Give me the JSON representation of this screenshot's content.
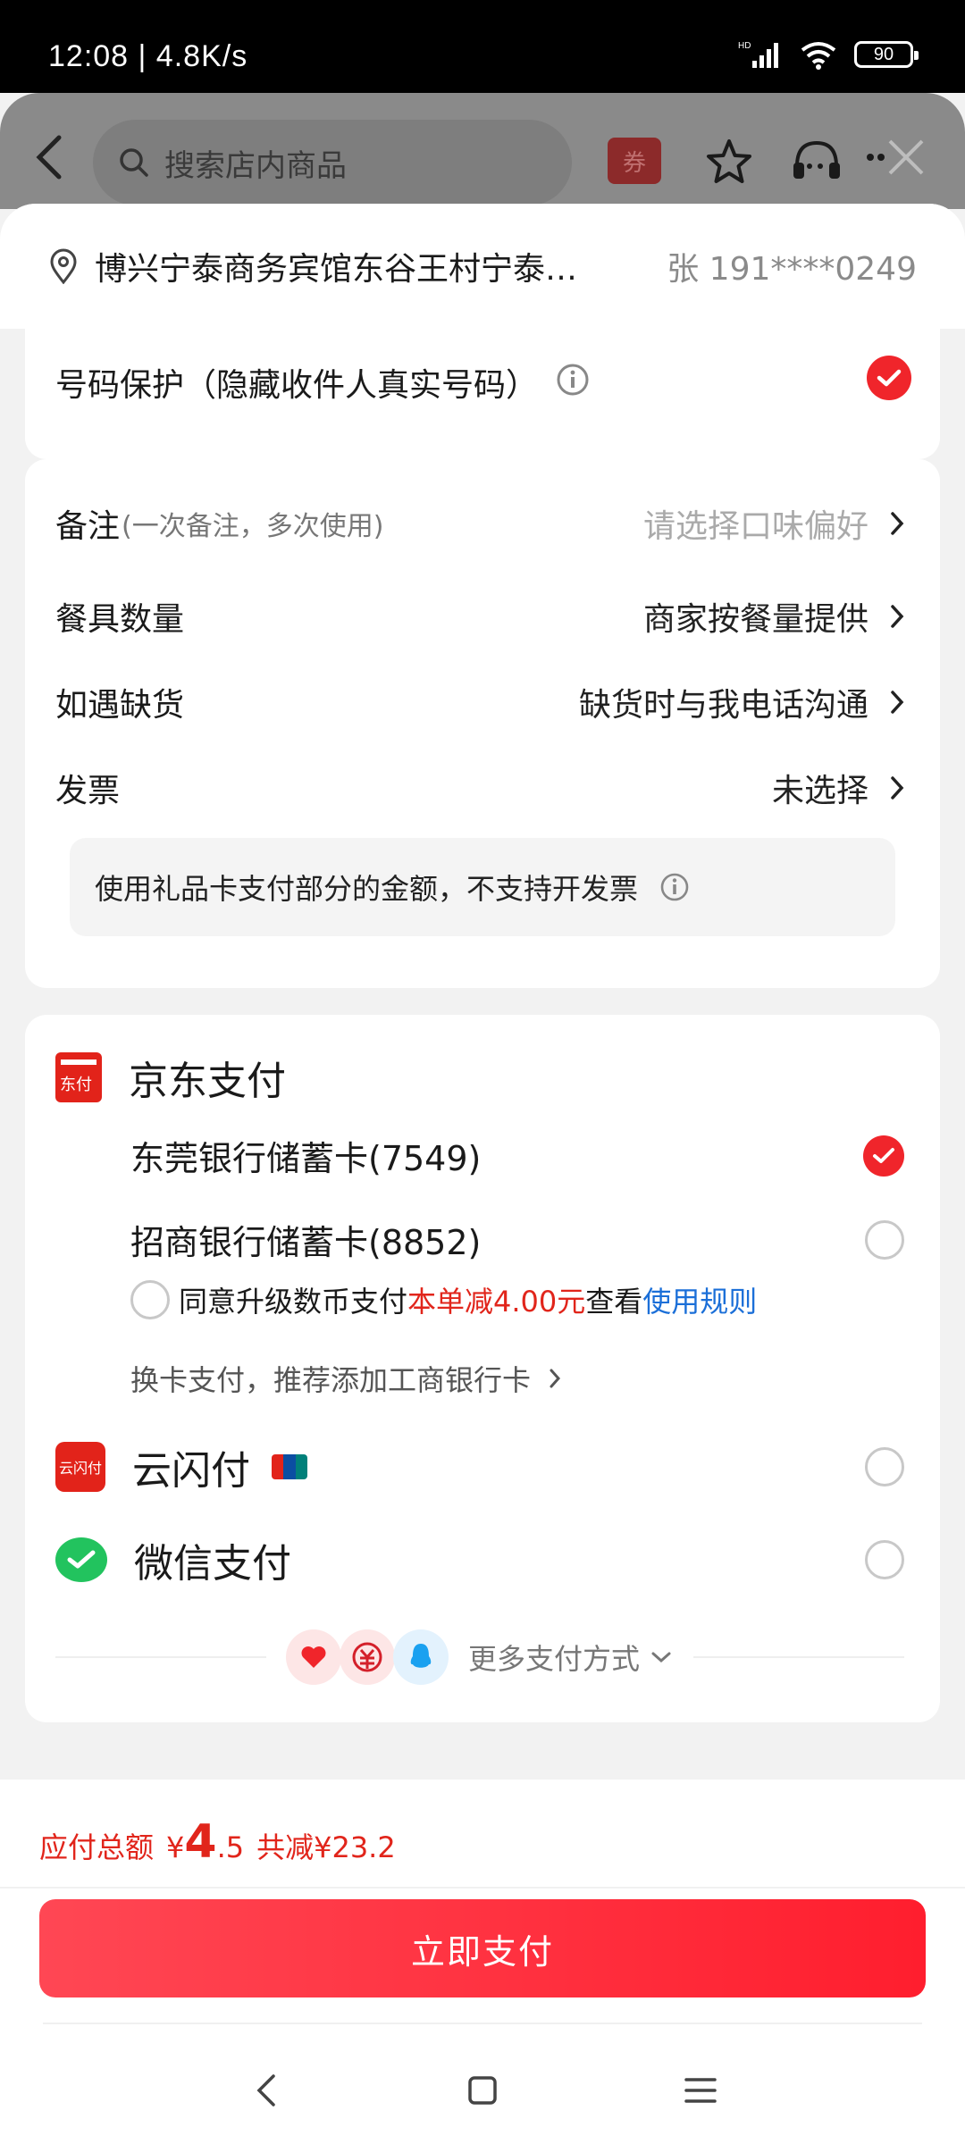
{
  "status_bar": {
    "time": "12:08 | 4.8K/s",
    "battery": "90",
    "network": "HD"
  },
  "store_header": {
    "search_placeholder": "搜索店内商品",
    "coupon": "券"
  },
  "address": {
    "text": "博兴宁泰商务宾馆东谷王村宁泰…",
    "contact": "张  191****0249"
  },
  "phone_protection": {
    "label": "号码保护（隐藏收件人真实号码）",
    "checked": true
  },
  "order_options": {
    "notes": {
      "label": "备注",
      "hint": "(一次备注，多次使用)",
      "value": "请选择口味偏好"
    },
    "tableware": {
      "label": "餐具数量",
      "value": "商家按餐量提供"
    },
    "out_of_stock": {
      "label": "如遇缺货",
      "value": "缺货时与我电话沟通"
    },
    "invoice": {
      "label": "发票",
      "value": "未选择"
    },
    "invoice_note": "使用礼品卡支付部分的金额，不支持开发票"
  },
  "payment": {
    "jd_pay": {
      "title": "京东支付",
      "logo_text": "东付"
    },
    "banks": [
      {
        "name": "东莞银行储蓄卡(7549)",
        "selected": true
      },
      {
        "name": "招商银行储蓄卡(8852)",
        "selected": false
      }
    ],
    "agree": {
      "prefix": "同意升级数币支付",
      "discount": "本单减4.00元",
      "mid": "查看",
      "rules": "使用规则"
    },
    "change_card": "换卡支付，推荐添加工商银行卡",
    "methods": [
      {
        "name": "云闪付",
        "logo_text": "云闪付"
      },
      {
        "name": "微信支付"
      }
    ],
    "more": "更多支付方式"
  },
  "summary": {
    "label": "应付总额",
    "currency": "¥",
    "amount_int": "4",
    "amount_dec": ".5",
    "saved": "共减¥23.2"
  },
  "pay_button": "立即支付",
  "colors": {
    "accent": "#f0252b",
    "link": "#1b6fd8",
    "price": "#e1251b"
  }
}
